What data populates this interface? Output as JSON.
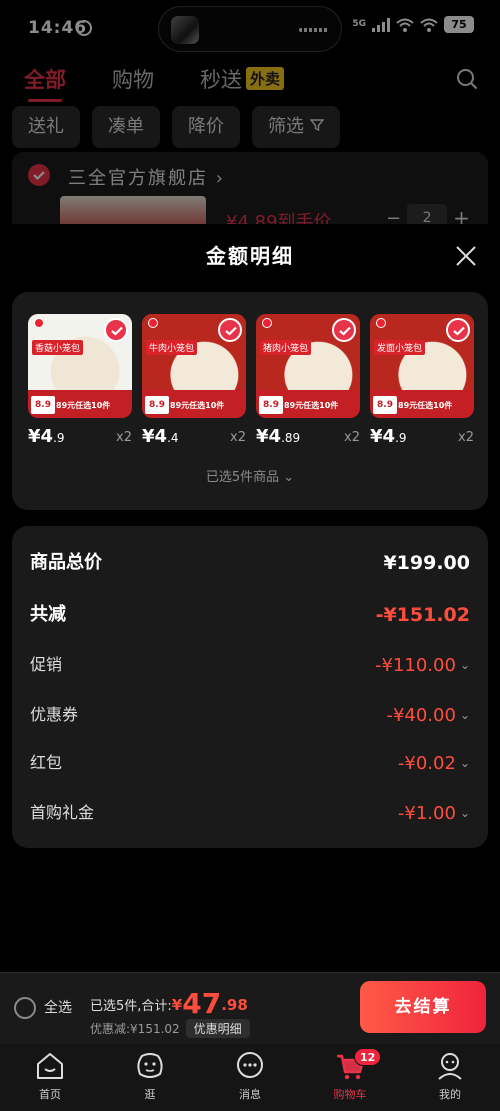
{
  "status_bar": {
    "time": "14:46",
    "network": "5G",
    "battery": "75"
  },
  "top_tabs": [
    {
      "label": "全部",
      "active": true
    },
    {
      "label": "购物",
      "active": false
    },
    {
      "label": "秒送",
      "badge": "外卖",
      "active": false
    }
  ],
  "filter_chips": [
    "送礼",
    "凑单",
    "降价",
    "筛选"
  ],
  "store": {
    "name": "三全官方旗舰店",
    "price_text": "¥4.89到手价",
    "quantity": "2"
  },
  "sheet": {
    "title": "金额明细",
    "products": [
      {
        "name": "香菇小笼包",
        "thumb_price": "8.9",
        "promo": "89元任选10件",
        "price": "¥4",
        "price_decimal": ".9",
        "qty": "x2"
      },
      {
        "name": "牛肉小笼包",
        "thumb_price": "8.9",
        "promo": "89元任选10件",
        "price": "¥4",
        "price_decimal": ".4",
        "qty": "x2"
      },
      {
        "name": "猪肉小笼包",
        "thumb_price": "8.9",
        "promo": "89元任选10件",
        "price": "¥4",
        "price_decimal": ".89",
        "qty": "x2"
      },
      {
        "name": "发面小笼包",
        "thumb_price": "8.9",
        "promo": "89元任选10件",
        "price": "¥4",
        "price_decimal": ".9",
        "qty": "x2"
      }
    ],
    "selected_text": "已选5件商品",
    "summary": [
      {
        "label": "商品总价",
        "value": "¥199.00",
        "style": "total"
      },
      {
        "label": "共减",
        "value": "-¥151.02",
        "style": "reduce"
      },
      {
        "label": "促销",
        "value": "-¥110.00",
        "style": "item"
      },
      {
        "label": "优惠券",
        "value": "-¥40.00",
        "style": "item"
      },
      {
        "label": "红包",
        "value": "-¥0.02",
        "style": "item"
      },
      {
        "label": "首购礼金",
        "value": "-¥1.00",
        "style": "item"
      }
    ]
  },
  "checkout": {
    "select_all": "全选",
    "summary_prefix": "已选5件,合计:",
    "currency": "¥",
    "amount": "47",
    "decimal": ".98",
    "discount": "优惠减:¥151.02",
    "detail_button": "优惠明细",
    "button": "去结算"
  },
  "nav": [
    {
      "label": "首页",
      "icon": "home-icon"
    },
    {
      "label": "逛",
      "icon": "explore-icon"
    },
    {
      "label": "消息",
      "icon": "message-icon"
    },
    {
      "label": "购物车",
      "icon": "cart-icon",
      "badge": "12",
      "active": true
    },
    {
      "label": "我的",
      "icon": "profile-icon"
    }
  ],
  "colors": {
    "accent": "#e8334a",
    "price_red": "#ff4d3d",
    "card_bg": "#1a1a1a"
  }
}
